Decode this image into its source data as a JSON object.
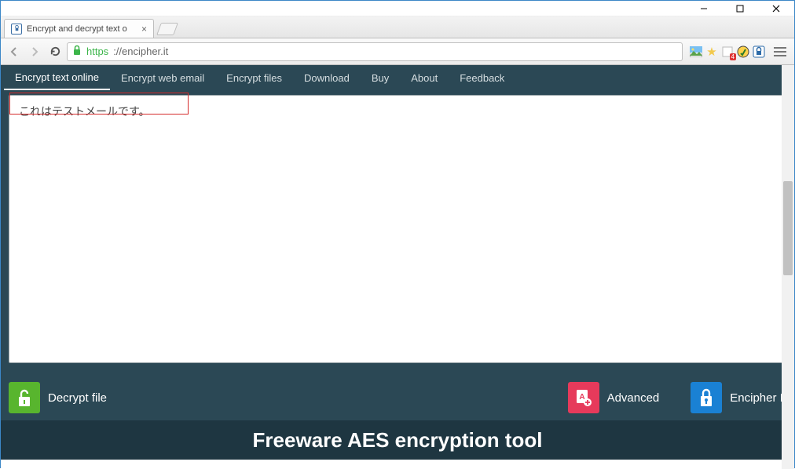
{
  "window": {
    "title": "Encrypt and decrypt text o"
  },
  "address": {
    "scheme": "https",
    "rest": "://encipher.it"
  },
  "nav": {
    "items": [
      "Encrypt text online",
      "Encrypt web email",
      "Encrypt files",
      "Download",
      "Buy",
      "About",
      "Feedback"
    ]
  },
  "editor": {
    "value": "これはテストメールです。"
  },
  "buttons": {
    "decrypt": "Decrypt file",
    "advanced": "Advanced",
    "encipher": "Encipher It"
  },
  "headline": "Freeware AES encryption tool",
  "ext_badge": "4"
}
